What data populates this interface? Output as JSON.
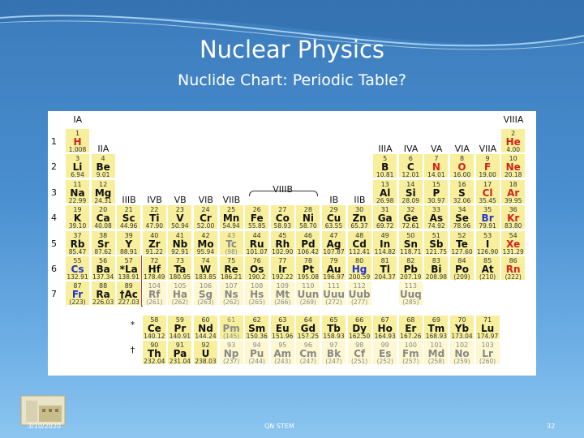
{
  "slide": {
    "title": "Nuclear Physics",
    "subtitle": "Nuclide Chart: Periodic Table?",
    "footer_date": "3/10/2020",
    "footer_org": "QN STEM",
    "page_number": "32"
  },
  "table": {
    "group_labels": [
      "IA",
      "IIA",
      "IIIB",
      "IVB",
      "VB",
      "VIB",
      "VIIB",
      "VIIIB",
      "IB",
      "IIB",
      "IIIA",
      "IVA",
      "VA",
      "VIA",
      "VIIA",
      "VIIIA"
    ],
    "row_labels": [
      "1",
      "2",
      "3",
      "4",
      "5",
      "6",
      "7"
    ],
    "lanthanide_marker": "*",
    "actinide_marker": "†",
    "elements": [
      {
        "n": "1",
        "s": "H",
        "m": "1.008",
        "r": 1,
        "c": 1,
        "k": "red"
      },
      {
        "n": "2",
        "s": "He",
        "m": "4.00",
        "r": 1,
        "c": 18,
        "k": "red"
      },
      {
        "n": "3",
        "s": "Li",
        "m": "6.94",
        "r": 2,
        "c": 1
      },
      {
        "n": "4",
        "s": "Be",
        "m": "9.01",
        "r": 2,
        "c": 2
      },
      {
        "n": "5",
        "s": "B",
        "m": "10.81",
        "r": 2,
        "c": 13
      },
      {
        "n": "6",
        "s": "C",
        "m": "12.01",
        "r": 2,
        "c": 14
      },
      {
        "n": "7",
        "s": "N",
        "m": "14.01",
        "r": 2,
        "c": 15,
        "k": "red"
      },
      {
        "n": "8",
        "s": "O",
        "m": "16.00",
        "r": 2,
        "c": 16,
        "k": "red"
      },
      {
        "n": "9",
        "s": "F",
        "m": "19.00",
        "r": 2,
        "c": 17,
        "k": "red"
      },
      {
        "n": "10",
        "s": "Ne",
        "m": "20.18",
        "r": 2,
        "c": 18,
        "k": "red"
      },
      {
        "n": "11",
        "s": "Na",
        "m": "22.99",
        "r": 3,
        "c": 1
      },
      {
        "n": "12",
        "s": "Mg",
        "m": "24.31",
        "r": 3,
        "c": 2
      },
      {
        "n": "13",
        "s": "Al",
        "m": "26.98",
        "r": 3,
        "c": 13
      },
      {
        "n": "14",
        "s": "Si",
        "m": "28.09",
        "r": 3,
        "c": 14
      },
      {
        "n": "15",
        "s": "P",
        "m": "30.97",
        "r": 3,
        "c": 15
      },
      {
        "n": "16",
        "s": "S",
        "m": "32.06",
        "r": 3,
        "c": 16
      },
      {
        "n": "17",
        "s": "Cl",
        "m": "35.45",
        "r": 3,
        "c": 17,
        "k": "red"
      },
      {
        "n": "18",
        "s": "Ar",
        "m": "39.95",
        "r": 3,
        "c": 18,
        "k": "red"
      },
      {
        "n": "19",
        "s": "K",
        "m": "39.10",
        "r": 4,
        "c": 1
      },
      {
        "n": "20",
        "s": "Ca",
        "m": "40.08",
        "r": 4,
        "c": 2
      },
      {
        "n": "21",
        "s": "Sc",
        "m": "44.96",
        "r": 4,
        "c": 3
      },
      {
        "n": "22",
        "s": "Ti",
        "m": "47.90",
        "r": 4,
        "c": 4
      },
      {
        "n": "23",
        "s": "V",
        "m": "50.94",
        "r": 4,
        "c": 5
      },
      {
        "n": "24",
        "s": "Cr",
        "m": "52.00",
        "r": 4,
        "c": 6
      },
      {
        "n": "25",
        "s": "Mn",
        "m": "54.94",
        "r": 4,
        "c": 7
      },
      {
        "n": "26",
        "s": "Fe",
        "m": "55.85",
        "r": 4,
        "c": 8
      },
      {
        "n": "27",
        "s": "Co",
        "m": "58.93",
        "r": 4,
        "c": 9
      },
      {
        "n": "28",
        "s": "Ni",
        "m": "58.70",
        "r": 4,
        "c": 10
      },
      {
        "n": "29",
        "s": "Cu",
        "m": "63.55",
        "r": 4,
        "c": 11
      },
      {
        "n": "30",
        "s": "Zn",
        "m": "65.37",
        "r": 4,
        "c": 12
      },
      {
        "n": "31",
        "s": "Ga",
        "m": "69.72",
        "r": 4,
        "c": 13
      },
      {
        "n": "32",
        "s": "Ge",
        "m": "72.61",
        "r": 4,
        "c": 14
      },
      {
        "n": "33",
        "s": "As",
        "m": "74.92",
        "r": 4,
        "c": 15
      },
      {
        "n": "34",
        "s": "Se",
        "m": "78.96",
        "r": 4,
        "c": 16
      },
      {
        "n": "35",
        "s": "Br",
        "m": "79.91",
        "r": 4,
        "c": 17,
        "k": "blue"
      },
      {
        "n": "36",
        "s": "Kr",
        "m": "83.80",
        "r": 4,
        "c": 18,
        "k": "red"
      },
      {
        "n": "37",
        "s": "Rb",
        "m": "85.47",
        "r": 5,
        "c": 1
      },
      {
        "n": "38",
        "s": "Sr",
        "m": "87.62",
        "r": 5,
        "c": 2
      },
      {
        "n": "39",
        "s": "Y",
        "m": "88.91",
        "r": 5,
        "c": 3
      },
      {
        "n": "40",
        "s": "Zr",
        "m": "91.22",
        "r": 5,
        "c": 4
      },
      {
        "n": "41",
        "s": "Nb",
        "m": "92.91",
        "r": 5,
        "c": 5
      },
      {
        "n": "42",
        "s": "Mo",
        "m": "95.94",
        "r": 5,
        "c": 6
      },
      {
        "n": "43",
        "s": "Tc",
        "m": "(98)",
        "r": 5,
        "c": 7,
        "k": "gray"
      },
      {
        "n": "44",
        "s": "Ru",
        "m": "101.07",
        "r": 5,
        "c": 8
      },
      {
        "n": "45",
        "s": "Rh",
        "m": "102.90",
        "r": 5,
        "c": 9
      },
      {
        "n": "46",
        "s": "Pd",
        "m": "106.42",
        "r": 5,
        "c": 10
      },
      {
        "n": "47",
        "s": "Ag",
        "m": "107.87",
        "r": 5,
        "c": 11
      },
      {
        "n": "48",
        "s": "Cd",
        "m": "112.41",
        "r": 5,
        "c": 12
      },
      {
        "n": "49",
        "s": "In",
        "m": "114.82",
        "r": 5,
        "c": 13
      },
      {
        "n": "50",
        "s": "Sn",
        "m": "118.71",
        "r": 5,
        "c": 14
      },
      {
        "n": "51",
        "s": "Sb",
        "m": "121.75",
        "r": 5,
        "c": 15
      },
      {
        "n": "52",
        "s": "Te",
        "m": "127.60",
        "r": 5,
        "c": 16
      },
      {
        "n": "53",
        "s": "I",
        "m": "126.90",
        "r": 5,
        "c": 17
      },
      {
        "n": "54",
        "s": "Xe",
        "m": "131.29",
        "r": 5,
        "c": 18,
        "k": "red"
      },
      {
        "n": "55",
        "s": "Cs",
        "m": "132.91",
        "r": 6,
        "c": 1,
        "k": "blue"
      },
      {
        "n": "56",
        "s": "Ba",
        "m": "137.34",
        "r": 6,
        "c": 2
      },
      {
        "n": "57",
        "s": "*La",
        "m": "138.91",
        "r": 6,
        "c": 3
      },
      {
        "n": "72",
        "s": "Hf",
        "m": "178.49",
        "r": 6,
        "c": 4
      },
      {
        "n": "73",
        "s": "Ta",
        "m": "180.95",
        "r": 6,
        "c": 5
      },
      {
        "n": "74",
        "s": "W",
        "m": "183.85",
        "r": 6,
        "c": 6
      },
      {
        "n": "75",
        "s": "Re",
        "m": "186.21",
        "r": 6,
        "c": 7
      },
      {
        "n": "76",
        "s": "Os",
        "m": "190.2",
        "r": 6,
        "c": 8
      },
      {
        "n": "77",
        "s": "Ir",
        "m": "192.22",
        "r": 6,
        "c": 9
      },
      {
        "n": "78",
        "s": "Pt",
        "m": "195.08",
        "r": 6,
        "c": 10
      },
      {
        "n": "79",
        "s": "Au",
        "m": "196.97",
        "r": 6,
        "c": 11
      },
      {
        "n": "80",
        "s": "Hg",
        "m": "200.59",
        "r": 6,
        "c": 12,
        "k": "blue"
      },
      {
        "n": "81",
        "s": "Tl",
        "m": "204.37",
        "r": 6,
        "c": 13
      },
      {
        "n": "82",
        "s": "Pb",
        "m": "207.19",
        "r": 6,
        "c": 14
      },
      {
        "n": "83",
        "s": "Bi",
        "m": "208.98",
        "r": 6,
        "c": 15
      },
      {
        "n": "84",
        "s": "Po",
        "m": "(209)",
        "r": 6,
        "c": 16
      },
      {
        "n": "85",
        "s": "At",
        "m": "(210)",
        "r": 6,
        "c": 17
      },
      {
        "n": "86",
        "s": "Rn",
        "m": "(222)",
        "r": 6,
        "c": 18,
        "k": "red"
      },
      {
        "n": "87",
        "s": "Fr",
        "m": "(223)",
        "r": 7,
        "c": 1,
        "k": "blue"
      },
      {
        "n": "88",
        "s": "Ra",
        "m": "226.03",
        "r": 7,
        "c": 2
      },
      {
        "n": "89",
        "s": "†Ac",
        "m": "227.03",
        "r": 7,
        "c": 3
      },
      {
        "n": "104",
        "s": "Rf",
        "m": "(261)",
        "r": 7,
        "c": 4,
        "k": "gray",
        "p": 1
      },
      {
        "n": "105",
        "s": "Ha",
        "m": "(262)",
        "r": 7,
        "c": 5,
        "k": "gray",
        "p": 1
      },
      {
        "n": "106",
        "s": "Sg",
        "m": "(263)",
        "r": 7,
        "c": 6,
        "k": "gray",
        "p": 1
      },
      {
        "n": "107",
        "s": "Ns",
        "m": "(262)",
        "r": 7,
        "c": 7,
        "k": "gray",
        "p": 1
      },
      {
        "n": "108",
        "s": "Hs",
        "m": "(265)",
        "r": 7,
        "c": 8,
        "k": "gray",
        "p": 1
      },
      {
        "n": "109",
        "s": "Mt",
        "m": "(266)",
        "r": 7,
        "c": 9,
        "k": "gray",
        "p": 1
      },
      {
        "n": "110",
        "s": "Uun",
        "m": "(269)",
        "r": 7,
        "c": 10,
        "k": "gray",
        "p": 1
      },
      {
        "n": "111",
        "s": "Uuu",
        "m": "(272)",
        "r": 7,
        "c": 11,
        "k": "gray",
        "p": 1
      },
      {
        "n": "112",
        "s": "Uub",
        "m": "(277)",
        "r": 7,
        "c": 12,
        "k": "gray",
        "p": 1
      },
      {
        "n": "113",
        "s": "Uuq",
        "m": "(285)",
        "r": 7,
        "c": 14,
        "k": "gray",
        "p": 1
      },
      {
        "n": "58",
        "s": "Ce",
        "m": "140.12",
        "r": 9,
        "c": 4
      },
      {
        "n": "59",
        "s": "Pr",
        "m": "140.91",
        "r": 9,
        "c": 5
      },
      {
        "n": "60",
        "s": "Nd",
        "m": "144.24",
        "r": 9,
        "c": 6
      },
      {
        "n": "61",
        "s": "Pm",
        "m": "(145)",
        "r": 9,
        "c": 7,
        "k": "gray"
      },
      {
        "n": "62",
        "s": "Sm",
        "m": "150.36",
        "r": 9,
        "c": 8
      },
      {
        "n": "63",
        "s": "Eu",
        "m": "151.96",
        "r": 9,
        "c": 9
      },
      {
        "n": "64",
        "s": "Gd",
        "m": "157.25",
        "r": 9,
        "c": 10
      },
      {
        "n": "65",
        "s": "Tb",
        "m": "158.93",
        "r": 9,
        "c": 11
      },
      {
        "n": "66",
        "s": "Dy",
        "m": "162.50",
        "r": 9,
        "c": 12
      },
      {
        "n": "67",
        "s": "Ho",
        "m": "164.93",
        "r": 9,
        "c": 13
      },
      {
        "n": "68",
        "s": "Er",
        "m": "167.26",
        "r": 9,
        "c": 14
      },
      {
        "n": "69",
        "s": "Tm",
        "m": "168.93",
        "r": 9,
        "c": 15
      },
      {
        "n": "70",
        "s": "Yb",
        "m": "173.04",
        "r": 9,
        "c": 16
      },
      {
        "n": "71",
        "s": "Lu",
        "m": "174.97",
        "r": 9,
        "c": 17
      },
      {
        "n": "90",
        "s": "Th",
        "m": "232.04",
        "r": 10,
        "c": 4
      },
      {
        "n": "91",
        "s": "Pa",
        "m": "231.04",
        "r": 10,
        "c": 5
      },
      {
        "n": "92",
        "s": "U",
        "m": "238.03",
        "r": 10,
        "c": 6
      },
      {
        "n": "93",
        "s": "Np",
        "m": "(237)",
        "r": 10,
        "c": 7,
        "k": "gray",
        "p": 1
      },
      {
        "n": "94",
        "s": "Pu",
        "m": "(244)",
        "r": 10,
        "c": 8,
        "k": "gray",
        "p": 1
      },
      {
        "n": "95",
        "s": "Am",
        "m": "(243)",
        "r": 10,
        "c": 9,
        "k": "gray",
        "p": 1
      },
      {
        "n": "96",
        "s": "Cm",
        "m": "(247)",
        "r": 10,
        "c": 10,
        "k": "gray",
        "p": 1
      },
      {
        "n": "97",
        "s": "Bk",
        "m": "(247)",
        "r": 10,
        "c": 11,
        "k": "gray",
        "p": 1
      },
      {
        "n": "98",
        "s": "Cf",
        "m": "(251)",
        "r": 10,
        "c": 12,
        "k": "gray",
        "p": 1
      },
      {
        "n": "99",
        "s": "Es",
        "m": "(252)",
        "r": 10,
        "c": 13,
        "k": "gray",
        "p": 1
      },
      {
        "n": "100",
        "s": "Fm",
        "m": "(257)",
        "r": 10,
        "c": 14,
        "k": "gray",
        "p": 1
      },
      {
        "n": "101",
        "s": "Md",
        "m": "(258)",
        "r": 10,
        "c": 15,
        "k": "gray",
        "p": 1
      },
      {
        "n": "102",
        "s": "No",
        "m": "(259)",
        "r": 10,
        "c": 16,
        "k": "gray",
        "p": 1
      },
      {
        "n": "103",
        "s": "Lr",
        "m": "(260)",
        "r": 10,
        "c": 17,
        "k": "gray",
        "p": 1
      }
    ]
  }
}
